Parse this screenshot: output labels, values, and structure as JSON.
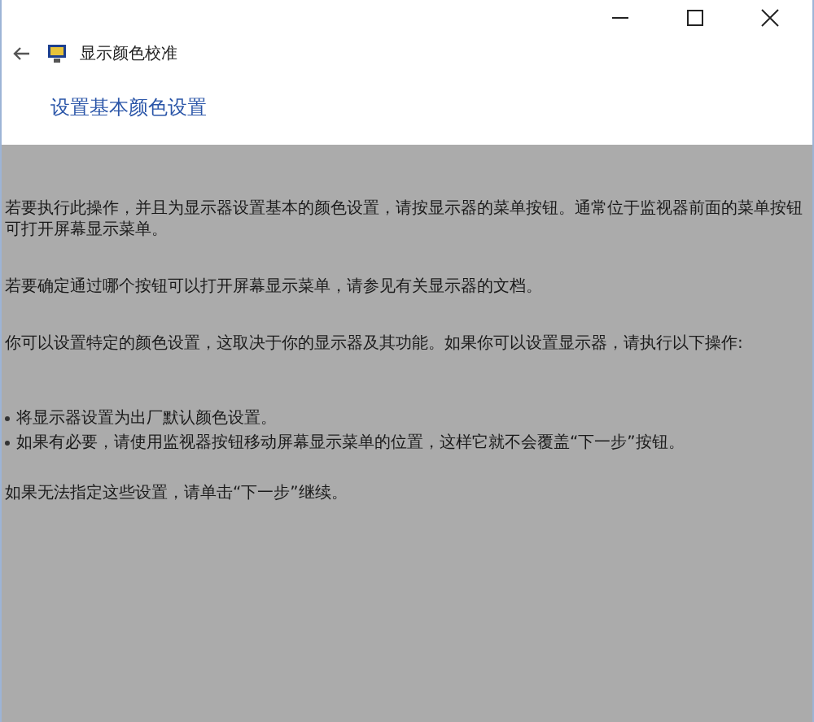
{
  "window": {
    "title": "显示颜色校准"
  },
  "heading": "设置基本颜色设置",
  "paragraphs": [
    {
      "kind": "text",
      "text": "若要执行此操作，并且为显示器设置基本的颜色设置，请按显示器的菜单按钮。通常位于监视器前面的菜单按钮可打开屏幕显示菜单。"
    },
    {
      "kind": "text",
      "text": "若要确定通过哪个按钮可以打开屏幕显示菜单，请参见有关显示器的文档。"
    },
    {
      "kind": "text",
      "text": "你可以设置特定的颜色设置，这取决于你的显示器及其功能。如果你可以设置显示器，请执行以下操作:"
    },
    {
      "kind": "list",
      "items": [
        "将显示器设置为出厂默认颜色设置。",
        "如果有必要，请使用监视器按钮移动屏幕显示菜单的位置，这样它就不会覆盖“下一步”按钮。"
      ]
    },
    {
      "kind": "text",
      "text": "如果无法指定这些设置，请单击“下一步”继续。"
    }
  ]
}
